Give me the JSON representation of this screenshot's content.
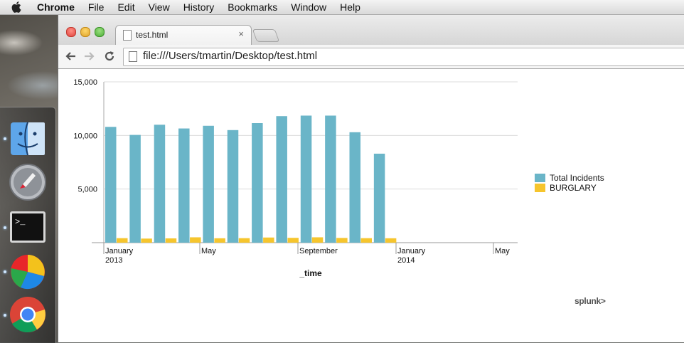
{
  "menubar": {
    "app_name": "Chrome",
    "items": [
      "File",
      "Edit",
      "View",
      "History",
      "Bookmarks",
      "Window",
      "Help"
    ]
  },
  "dock": {
    "apps": [
      "finder-icon",
      "launchpad-icon",
      "terminal-icon",
      "pie-app-icon",
      "chrome-icon"
    ]
  },
  "browser": {
    "tab_title": "test.html",
    "tab_close": "×",
    "url": "file:///Users/tmartin/Desktop/test.html"
  },
  "chart_data": {
    "type": "bar",
    "xlabel": "_time",
    "ylabel": "",
    "ylim": [
      0,
      15000
    ],
    "y_ticks": [
      "15,000",
      "10,000",
      "5,000"
    ],
    "x_ticks": [
      {
        "month": "January",
        "year": "2013"
      },
      {
        "month": "May",
        "year": ""
      },
      {
        "month": "September",
        "year": ""
      },
      {
        "month": "January",
        "year": "2014"
      },
      {
        "month": "May",
        "year": ""
      }
    ],
    "categories": [
      "2013-01",
      "2013-02",
      "2013-03",
      "2013-04",
      "2013-05",
      "2013-06",
      "2013-07",
      "2013-08",
      "2013-09",
      "2013-10",
      "2013-11",
      "2013-12"
    ],
    "series": [
      {
        "name": "Total Incidents",
        "color": "#6ab5c8",
        "values": [
          10800,
          10050,
          11000,
          10650,
          10900,
          10500,
          11150,
          11800,
          11850,
          11850,
          10300,
          8300
        ]
      },
      {
        "name": "BURGLARY",
        "color": "#f6c52d",
        "values": [
          420,
          380,
          400,
          500,
          410,
          420,
          480,
          450,
          500,
          440,
          420,
          410
        ]
      }
    ],
    "grid": true,
    "legend_position": "right"
  },
  "watermark": "splunk>"
}
